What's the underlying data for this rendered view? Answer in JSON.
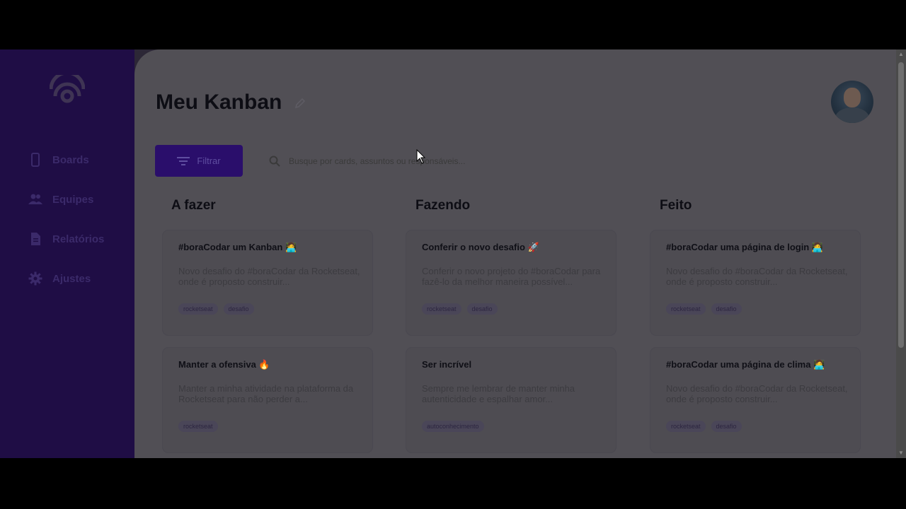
{
  "sidebar": {
    "items": [
      {
        "label": "Boards",
        "icon": "phone-icon"
      },
      {
        "label": "Equipes",
        "icon": "users-icon"
      },
      {
        "label": "Relatórios",
        "icon": "document-icon"
      },
      {
        "label": "Ajustes",
        "icon": "gear-icon"
      }
    ]
  },
  "header": {
    "title": "Meu Kanban"
  },
  "toolbar": {
    "filter_label": "Filtrar",
    "search_placeholder": "Busque por cards, assuntos ou responsáveis..."
  },
  "columns": [
    {
      "title": "A fazer",
      "cards": [
        {
          "title": "#boraCodar um Kanban 🧑‍💻",
          "desc": "Novo desafio do #boraCodar da Rocketseat, onde é proposto construir...",
          "tags": [
            "rocketseat",
            "desafio"
          ]
        },
        {
          "title": "Manter a ofensiva 🔥",
          "desc": "Manter a minha atividade na plataforma da Rocketseat para não perder a...",
          "tags": [
            "rocketseat"
          ]
        }
      ]
    },
    {
      "title": "Fazendo",
      "cards": [
        {
          "title": "Conferir o novo desafio 🚀",
          "desc": "Conferir o novo projeto do #boraCodar para fazê-lo da melhor maneira possível...",
          "tags": [
            "rocketseat",
            "desafio"
          ]
        },
        {
          "title": "Ser incrível",
          "desc": "Sempre me lembrar de manter minha autenticidade e espalhar amor...",
          "tags": [
            "autoconhecimento"
          ]
        }
      ]
    },
    {
      "title": "Feito",
      "cards": [
        {
          "title": "#boraCodar uma página de login 🧑‍💻",
          "desc": "Novo desafio do #boraCodar da Rocketseat, onde é proposto construir...",
          "tags": [
            "rocketseat",
            "desafio"
          ]
        },
        {
          "title": "#boraCodar uma página de clima 🧑‍💻",
          "desc": "Novo desafio do #boraCodar da Rocketseat, onde é proposto construir...",
          "tags": [
            "rocketseat",
            "desafio"
          ]
        }
      ]
    }
  ],
  "colors": {
    "sidebar_bg": "#1f0d45",
    "accent": "#2a0e6b",
    "main_bg": "#514f55"
  }
}
